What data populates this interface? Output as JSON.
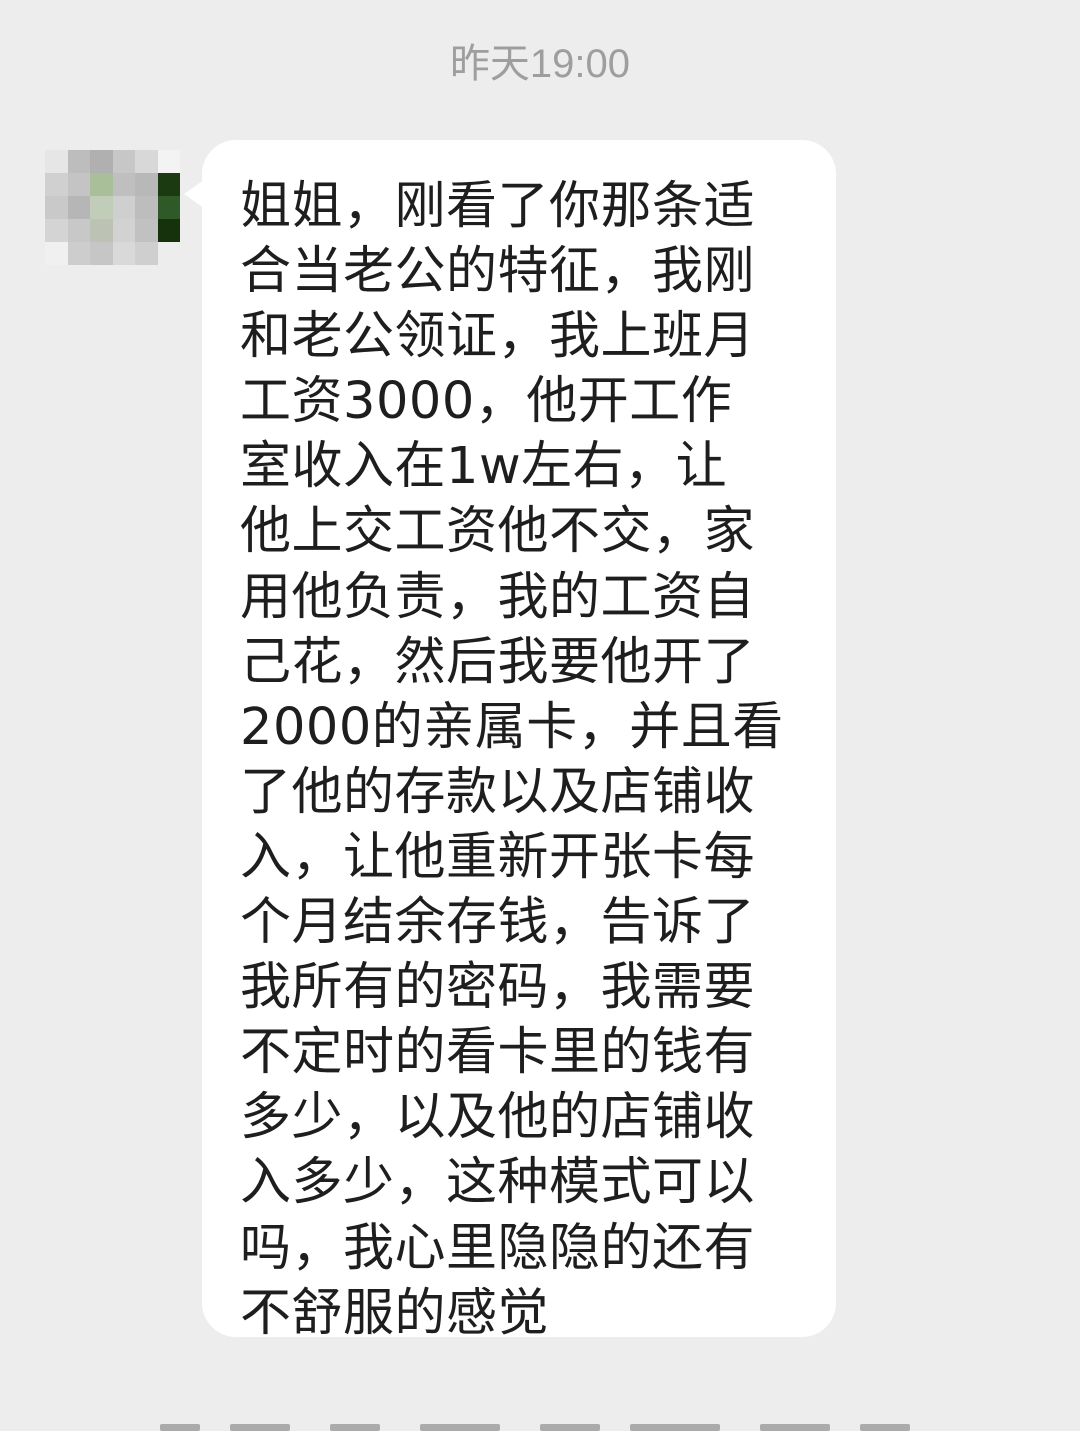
{
  "chat": {
    "timestamp": "昨天19:00",
    "avatar": {
      "icon": "blurred-avatar-icon",
      "mosaic_colors": [
        "#e6e6e6",
        "#bdbdbd",
        "#b0b0b0",
        "#c7c7c7",
        "#d8d8d8",
        "#f3f3f3",
        "#d0d0d0",
        "#c4c4c4",
        "#a9bf9a",
        "#bfbfbf",
        "#b8b8b8",
        "#1c3a12",
        "#c9c9c9",
        "#b6b6b6",
        "#c2cdb9",
        "#cfcfcf",
        "#bdbdbd",
        "#2f5a27",
        "#d4d4d4",
        "#c8c8c8",
        "#bcc3b5",
        "#d2d2d2",
        "#c1c1c1",
        "#16320d",
        "#f0f0f0",
        "#cdcdcd",
        "#c6c6c6",
        "#d9d9d9",
        "#cfcfcf",
        "#ededed"
      ]
    },
    "message": {
      "text": "姐姐，刚看了你那条适\n合当老公的特征，我刚\n和老公领证，我上班月\n工资3000，他开工作\n室收入在1w左右，让\n他上交工资他不交，家\n用他负责，我的工资自\n己花，然后我要他开了\n2000的亲属卡，并且看\n了他的存款以及店铺收\n入，让他重新开张卡每\n个月结余存钱，告诉了\n我所有的密码，我需要\n不定时的看卡里的钱有\n多少，以及他的店铺收\n入多少，这种模式可以\n吗，我心里隐隐的还有\n不舒服的感觉"
    }
  },
  "colors": {
    "background": "#ededed",
    "bubble": "#ffffff",
    "timestamp": "#9e9e9e",
    "text": "#1e1e1e"
  }
}
